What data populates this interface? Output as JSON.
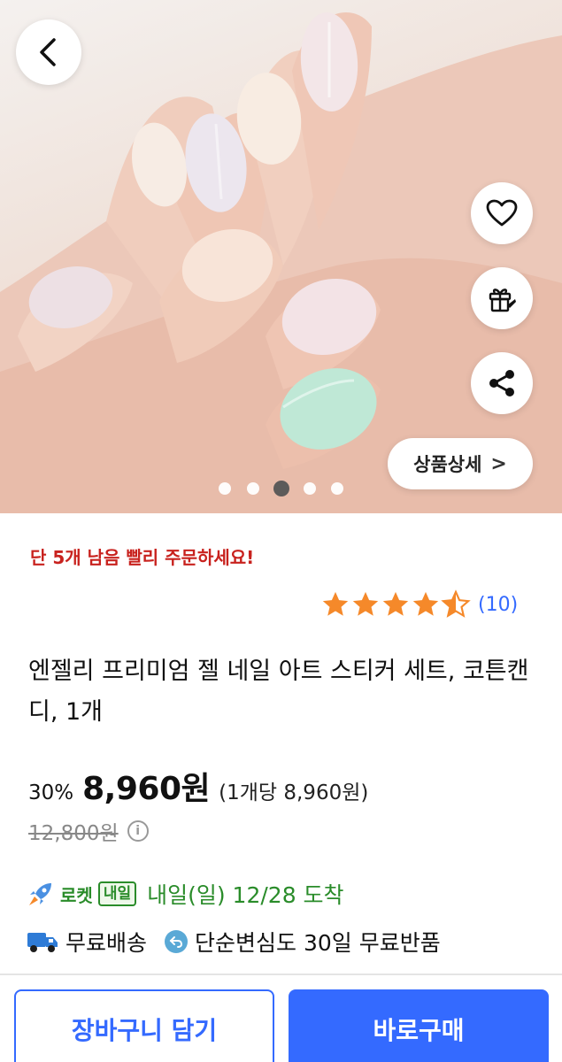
{
  "gallery": {
    "image_alt": "nail-art-hand-photo",
    "dots_count": 5,
    "active_dot": 2,
    "detail_button_label": "상품상세",
    "detail_chevron": ">"
  },
  "icons": {
    "back": "chevron-left-icon",
    "favorite": "heart-icon",
    "gift": "gift-icon",
    "share": "share-icon",
    "rocket": "rocket-icon",
    "truck": "truck-icon",
    "return": "return-icon",
    "info": "info-icon"
  },
  "product": {
    "stock_notice": "단 5개 남음 빨리 주문하세요!",
    "rating": 4.5,
    "review_count": "(10)",
    "title": "엔젤리 프리미엄 젤 네일 아트 스티커 세트, 코튼캔디, 1개",
    "discount": "30%",
    "price": "8,960원",
    "unit_price": "(1개당 8,960원)",
    "original_price": "12,800원"
  },
  "delivery": {
    "rocket_label": "로켓",
    "tomorrow_badge": "내일",
    "arrival": "내일(일) 12/28 도착",
    "free_shipping": "무료배송",
    "free_return": "단순변심도 30일 무료반품"
  },
  "actions": {
    "cart_label": "장바구니 담기",
    "buy_label": "바로구매"
  },
  "colors": {
    "accent": "#346aff",
    "stock_red": "#c8221e",
    "rocket_green": "#2a8c2a",
    "star": "#f5892a"
  }
}
